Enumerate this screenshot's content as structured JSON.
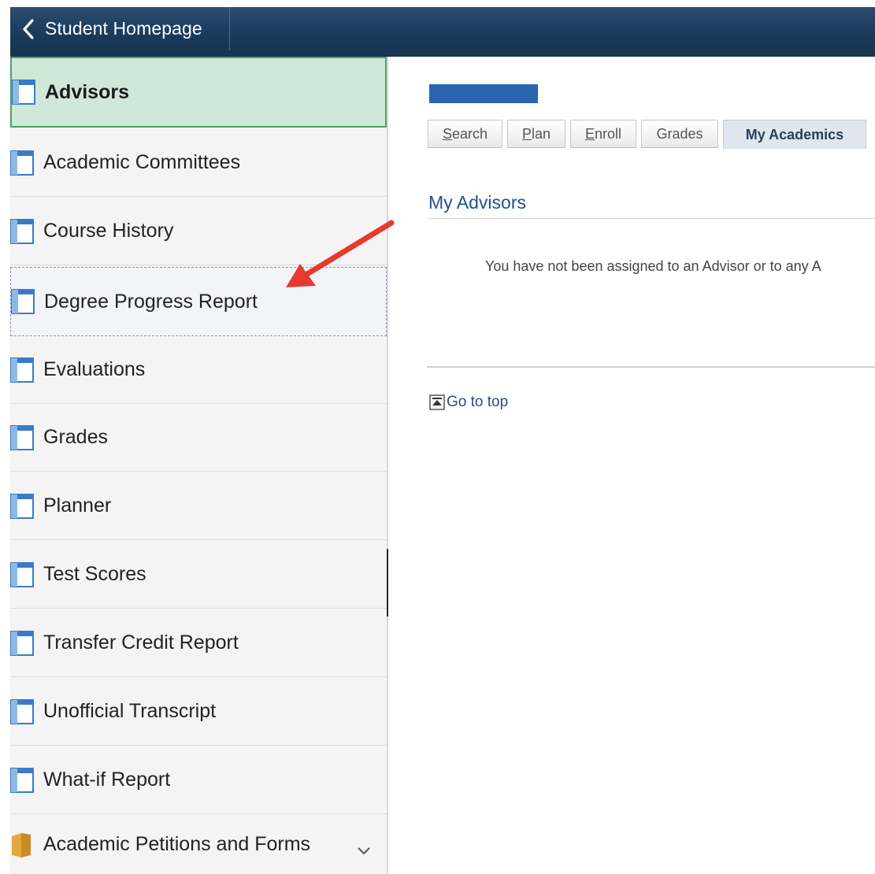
{
  "header": {
    "back_label": "Student Homepage"
  },
  "sidebar": {
    "items": [
      {
        "label": "Advisors",
        "icon": "page-icon",
        "state": "active"
      },
      {
        "label": "Academic Committees",
        "icon": "page-icon"
      },
      {
        "label": "Course History",
        "icon": "page-icon"
      },
      {
        "label": "Degree Progress Report",
        "icon": "page-icon",
        "state": "hover"
      },
      {
        "label": "Evaluations",
        "icon": "page-icon"
      },
      {
        "label": "Grades",
        "icon": "page-icon"
      },
      {
        "label": "Planner",
        "icon": "page-icon"
      },
      {
        "label": "Test Scores",
        "icon": "page-icon"
      },
      {
        "label": "Transfer Credit Report",
        "icon": "page-icon"
      },
      {
        "label": "Unofficial Transcript",
        "icon": "page-icon"
      },
      {
        "label": "What-if Report",
        "icon": "page-icon"
      },
      {
        "label": "Academic Petitions and Forms",
        "icon": "folder-icon",
        "expandable": true
      }
    ]
  },
  "main": {
    "tabs": [
      {
        "label": "Search",
        "access_key_char": "S",
        "rest": "earch"
      },
      {
        "label": "Plan",
        "access_key_char": "P",
        "rest": "lan"
      },
      {
        "label": "Enroll",
        "access_key_char": "E",
        "rest": "nroll"
      },
      {
        "label": "Grades"
      },
      {
        "label": "My Academics",
        "selected": true
      }
    ],
    "section_title": "My Advisors",
    "message": "You have not been assigned to an Advisor or to any A",
    "go_top_label": "Go to top"
  },
  "colors": {
    "header_bg": "#1b3a5c",
    "active_item_bg": "#cfe8d8",
    "active_item_border": "#4aa36a",
    "link_blue": "#1f4f8f",
    "annotation_red": "#e53b2e"
  }
}
